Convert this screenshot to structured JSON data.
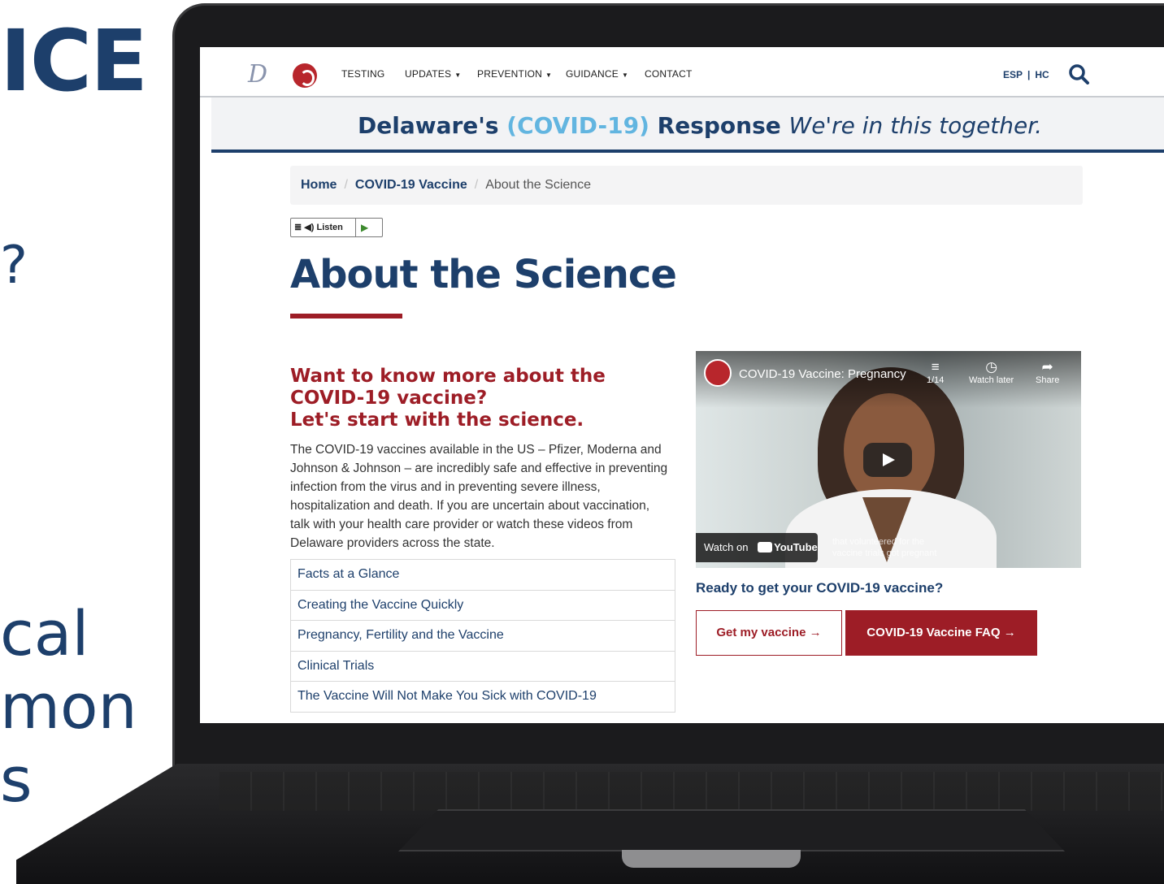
{
  "slide": {
    "heading_fragment": "ICE",
    "glyph_fragment": "?",
    "line1": "cal",
    "line2": "mon",
    "line3": "s"
  },
  "site": {
    "nav": {
      "items": [
        {
          "label": "TESTING"
        },
        {
          "label": "UPDATES"
        },
        {
          "label": "PREVENTION"
        },
        {
          "label": "GUIDANCE"
        },
        {
          "label": "CONTACT"
        }
      ],
      "lang_esp": "ESP",
      "lang_sep": "|",
      "lang_hc": "HC"
    },
    "banner": {
      "part1": "Delaware's ",
      "part2": "(COVID-19)",
      "part3": " Response ",
      "part4": "We're in this together."
    },
    "breadcrumb": {
      "home": "Home",
      "sep": "/",
      "vaccine": "COVID-19 Vaccine",
      "current": "About the Science"
    },
    "listen_label": "Listen",
    "page_title": "About the Science",
    "intro": {
      "heading_line1": "Want to know more about the",
      "heading_line2": "COVID-19 vaccine?",
      "heading_line3": "Let's start with the science.",
      "body": "The COVID-19 vaccines available in the US – Pfizer, Moderna and Johnson & Johnson – are incredibly safe and effective in preventing infection from the virus and in preventing severe illness, hospitalization and death. If you are uncertain about vaccination, talk with your health care provider or watch these videos from Delaware providers across the state."
    },
    "links": [
      {
        "label": "Facts at a Glance"
      },
      {
        "label": "Creating the Vaccine Quickly"
      },
      {
        "label": "Pregnancy, Fertility and the Vaccine"
      },
      {
        "label": "Clinical Trials"
      },
      {
        "label": "The Vaccine Will Not Make You Sick with COVID-19"
      }
    ],
    "video": {
      "title": "COVID-19 Vaccine: Pregnancy",
      "playlist_count": "1/14",
      "watch_later": "Watch later",
      "share": "Share",
      "watch_on": "Watch on",
      "youtube": "YouTube",
      "caption": "that volunteered for the vaccine trials got pregnant"
    },
    "cta": {
      "ready": "Ready to get your COVID-19 vaccine?",
      "get_vaccine": "Get my vaccine →",
      "faq": "COVID-19 Vaccine FAQ →"
    }
  },
  "colors": {
    "navy": "#1d3f6b",
    "crimson": "#9d1d26",
    "light_blue": "#62b5e0"
  }
}
